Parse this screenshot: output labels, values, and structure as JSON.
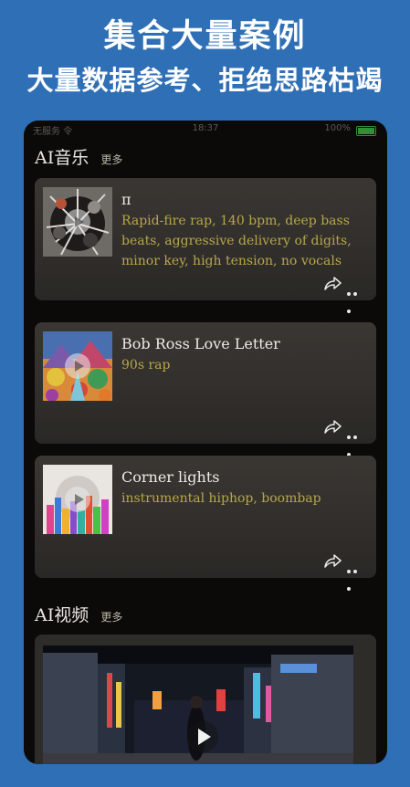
{
  "promo": {
    "title": "集合大量案例",
    "subtitle": "大量数据参考、拒绝思路枯竭"
  },
  "status_bar": {
    "carrier": "无服务 令",
    "time": "18:37",
    "battery": "100%"
  },
  "music_section": {
    "title": "AI音乐",
    "more": "更多",
    "songs": [
      {
        "title": "π",
        "description": "Rapid-fire rap, 140 bpm, deep bass beats, aggressive delivery of digits, minor key, high tension, no vocals",
        "thumb_icon": "spiky-abstract-art"
      },
      {
        "title": "Bob Ross Love Letter",
        "description": "90s rap",
        "thumb_icon": "colorful-landscape-painting"
      },
      {
        "title": "Corner lights",
        "description": "instrumental hiphop, boombap",
        "thumb_icon": "city-skyline-art"
      }
    ]
  },
  "video_section": {
    "title": "AI视频",
    "more": "更多",
    "thumb_icon": "night-street-scene"
  },
  "colors": {
    "background": "#2f6fb5",
    "phone_bg": "#0b0a09",
    "card_bg": "#33312d",
    "accent_text": "#b8a64a"
  }
}
